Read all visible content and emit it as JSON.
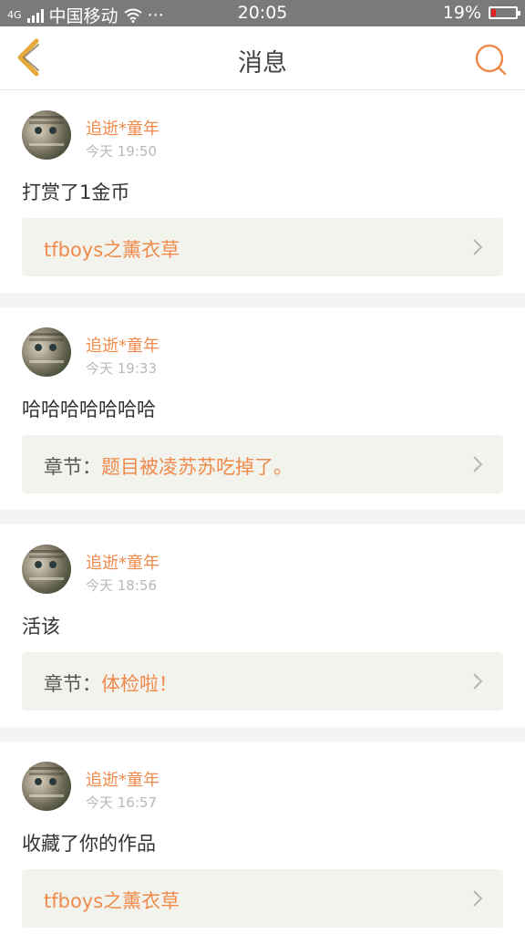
{
  "status": {
    "network": "4G",
    "carrier": "中国移动",
    "wifi_icon": "wifi-icon",
    "more": "···",
    "time": "20:05",
    "battery": "19%",
    "battery_level": 0.19,
    "battery_color": "#e02020"
  },
  "header": {
    "title": "消息",
    "back_icon": "chevron-left-icon",
    "search_icon": "search-icon",
    "accent": "#f08a4b"
  },
  "messages": [
    {
      "name": "追逝*童年",
      "time": "今天 19:50",
      "content": "打赏了1金币",
      "ref_prefix": "",
      "ref_link": "tfboys之薰衣草"
    },
    {
      "name": "追逝*童年",
      "time": "今天 19:33",
      "content": "哈哈哈哈哈哈哈",
      "ref_prefix": "章节：",
      "ref_link": "题目被凌苏苏吃掉了。"
    },
    {
      "name": "追逝*童年",
      "time": "今天 18:56",
      "content": "活该",
      "ref_prefix": "章节：",
      "ref_link": "体检啦！"
    },
    {
      "name": "追逝*童年",
      "time": "今天 16:57",
      "content": "收藏了你的作品",
      "ref_prefix": "",
      "ref_link": "tfboys之薰衣草"
    }
  ]
}
